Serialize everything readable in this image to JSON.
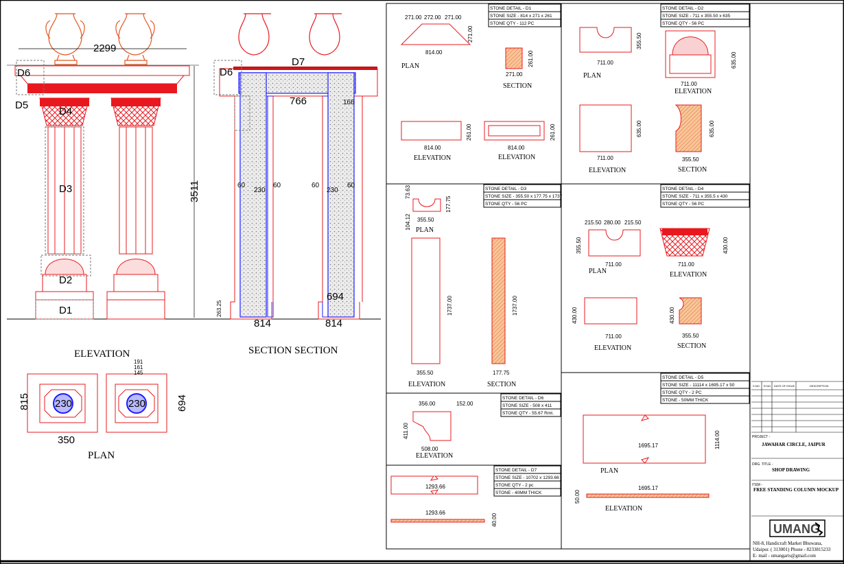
{
  "colors": {
    "stone_red": "#e8181e",
    "vase_orange": "#e2551f",
    "fill_orange": "#f2c08a",
    "frame_blue": "#1a1aff",
    "line": "#000000",
    "concrete": "#9a9a9a"
  },
  "main": {
    "elevation": {
      "width_dim": "2299",
      "height_dim": "3511",
      "labels": [
        "D6",
        "D5",
        "D4",
        "D3",
        "D2",
        "D1"
      ],
      "caption": "ELEVATION"
    },
    "section": {
      "top_label": "D7",
      "left_label": "D6",
      "inner_dim": "766",
      "side_dim": "166",
      "dims": [
        "60",
        "230",
        "60",
        "60",
        "230",
        "60"
      ],
      "base_left": "814",
      "base_right": "814",
      "base_inner": "694",
      "base_height": "263.25",
      "caption": "SECTION  SECTION"
    },
    "plan": {
      "left_height": "815",
      "left_width": "350",
      "right_height": "694",
      "core_left": "230",
      "core_right": "230",
      "small_dims": [
        "191",
        "161",
        "145"
      ],
      "caption": "PLAN"
    }
  },
  "d1": {
    "detail": "STONE DETAIL  - D1",
    "size": "STONE SIZE  - 814 x 271 x 261",
    "qty": "STONE QTY  - 112 PC",
    "plan_top": [
      "271.00",
      "272.00",
      "271.00"
    ],
    "plan_side": "271.00",
    "plan_width": "814.00",
    "plan_caption": "PLAN",
    "section_side": "261.00",
    "section_width": "271.00",
    "section_caption": "SECTION",
    "elev1_width": "814.00",
    "elev1_side": "261.00",
    "elev1_caption": "ELEVATION",
    "elev2_width": "814.00",
    "elev2_side": "261.00",
    "elev2_caption": "ELEVATION"
  },
  "d2": {
    "detail": "STONE DETAIL  - D2",
    "size": "STONE SIZE  - 711 x 355.50 x 635",
    "qty": "STONE QTY  - 56 PC",
    "plan_side": "355.50",
    "plan_width": "711.00",
    "plan_caption": "PLAN",
    "elev_side": "635.00",
    "elev_width": "711.00",
    "elev_caption": "ELEVATION",
    "sq_side": "635.00",
    "sq_width": "711.00",
    "sq_caption": "ELEVATION",
    "sec_side": "635.00",
    "sec_width": "355.50",
    "sec_caption": "SECTION"
  },
  "d3": {
    "detail": "STONE DETAIL  - D3",
    "size": "STONE SIZE  - 355.50 x 177.75 x 1737",
    "qty": "STONE QTY  - 56 PC",
    "plan_dims": [
      "73.63",
      "104.12",
      "177.75",
      "355.50"
    ],
    "plan_caption": "PLAN",
    "elev_height": "1737.00",
    "elev_width": "355.50",
    "elev_caption": "ELEVATION",
    "sec_height": "1737.00",
    "sec_width": "177.75",
    "sec_caption": "SECTION"
  },
  "d4": {
    "detail": "STONE DETAIL  - D4",
    "size": "STONE SIZE  - 711 x 355.5 x 430",
    "qty": "STONE QTY  - 56 PC",
    "plan_top": [
      "215.50",
      "280.00",
      "215.50"
    ],
    "plan_side": "355.50",
    "plan_width": "711.00",
    "plan_caption": "PLAN",
    "elev_side": "430.00",
    "elev_width": "711.00",
    "elev_caption": "ELEVATION",
    "el2_side": "430.00",
    "el2_width": "711.00",
    "el2_caption": "ELEVATION",
    "sec_side": "430.00",
    "sec_width": "355.50",
    "sec_caption": "SECTION"
  },
  "d5": {
    "detail": "STONE DETAIL  - D5",
    "size": "STONE SIZE  - 11114 x 1695.17 x 50",
    "qty": "STONE QTY  - 2 PC",
    "stone": "STONE  - 50MM THICK",
    "plan_width": "1695.17",
    "plan_side": "1114.00",
    "plan_caption": "PLAN",
    "elev_width": "1695.17",
    "elev_side": "50.00",
    "elev_caption": "ELEVATION"
  },
  "d6": {
    "detail": "STONE DETAIL  - D6",
    "size": "STONE SIZE  - 508 x 411",
    "qty": "STONE QTY  - 55.67 Rmt.",
    "top1": "356.00",
    "top2": "152.00",
    "side": "411.00",
    "width": "508.00",
    "caption": "ELEVATION"
  },
  "d7": {
    "detail": "STONE DETAIL  - D7",
    "size": "STONE SIZE  - 10702 x 1293.66",
    "qty": "STONE QTY  - 2 pc",
    "stone": "STONE  - 40MM THICK",
    "width1": "1293.66",
    "width2": "1293.66",
    "side": "40.00"
  },
  "title_block": {
    "rev_headers": [
      "S.NO.",
      "R.NO.",
      "DATE OF ISSUE",
      "DESCRIPTION"
    ],
    "project_label": "PROJECT -",
    "project": "JAWAHAR CIRCLE, JAIPUR",
    "dwg_label": "DRG. TITLE -",
    "dwg_title": "SHOP DRAWING",
    "item_label": "ITEM -",
    "item": "FREE STANDING COLUMN MOCKUP",
    "logo": "UMANG",
    "address1": "NH-8, Handicraft Market Bhuwana,",
    "address2": "Udaipur. ( 313001) Phone - 8233815233",
    "email": "E- mail - umangarts@gmail.com"
  }
}
